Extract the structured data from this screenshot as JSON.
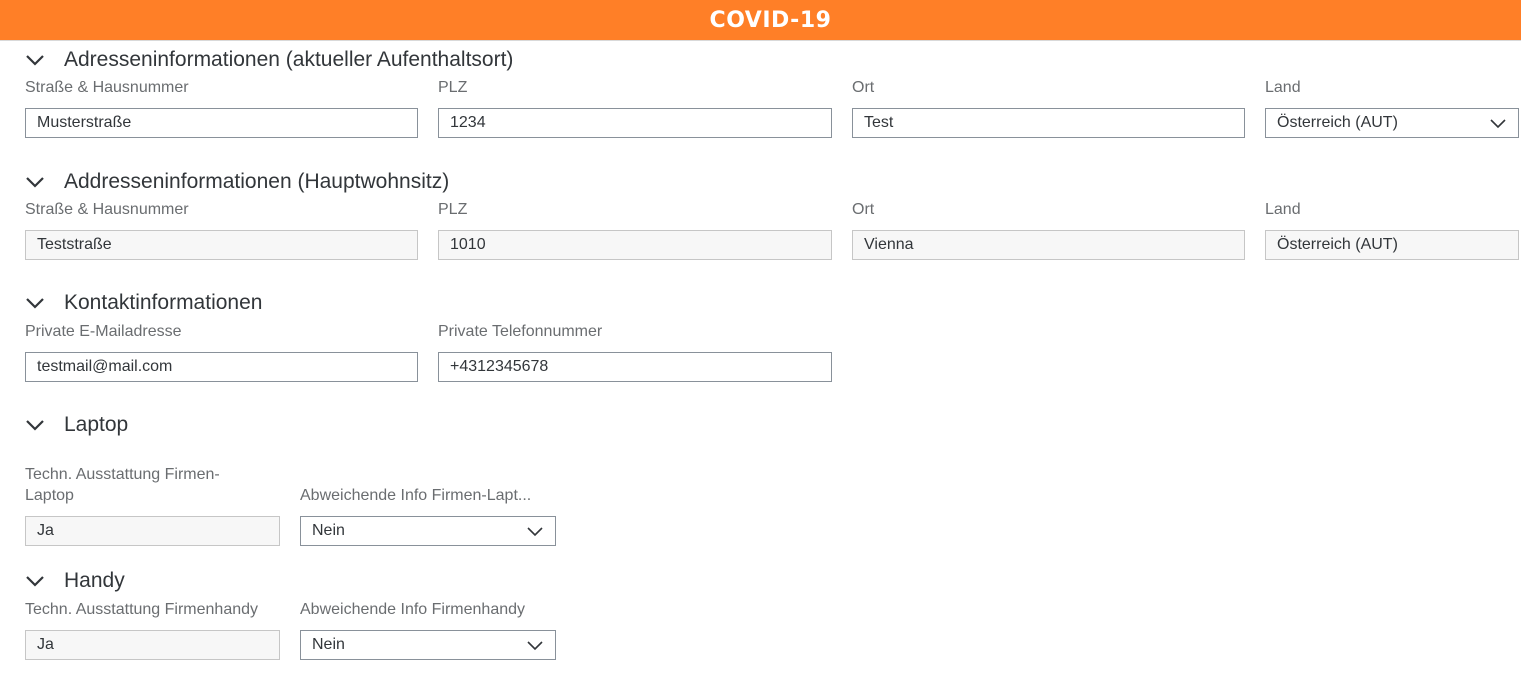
{
  "header": {
    "title": "COVID-19"
  },
  "current_address": {
    "heading": "Adresseninformationen (aktueller Aufenthaltsort)",
    "street_label": "Straße & Hausnummer",
    "street_value": "Musterstraße",
    "zip_label": "PLZ",
    "zip_value": "1234",
    "city_label": "Ort",
    "city_value": "Test",
    "country_label": "Land",
    "country_value": "Österreich (AUT)"
  },
  "main_address": {
    "heading": "Addresseninformationen (Hauptwohnsitz)",
    "street_label": "Straße & Hausnummer",
    "street_value": "Teststraße",
    "zip_label": "PLZ",
    "zip_value": "1010",
    "city_label": "Ort",
    "city_value": "Vienna",
    "country_label": "Land",
    "country_value": "Österreich (AUT)"
  },
  "contact": {
    "heading": "Kontaktinformationen",
    "email_label": "Private E-Mailadresse",
    "email_value": "testmail@mail.com",
    "phone_label": "Private Telefonnummer",
    "phone_value": "+4312345678"
  },
  "laptop": {
    "heading": "Laptop",
    "equipment_label_line1": "Techn. Ausstattung Firmen-",
    "equipment_label_line2": "Laptop",
    "equipment_value": "Ja",
    "deviating_label": "Abweichende Info Firmen-Lapt...",
    "deviating_value": "Nein"
  },
  "handy": {
    "heading": "Handy",
    "equipment_label": "Techn. Ausstattung Firmenhandy",
    "equipment_value": "Ja",
    "deviating_label": "Abweichende Info Firmenhandy",
    "deviating_value": "Nein"
  },
  "icons": {
    "section_toggle": "chevron-down-icon",
    "dropdown": "chevron-down-icon"
  },
  "colors": {
    "header_bg": "#ff7f27",
    "header_text": "#ffffff",
    "field_border": "#89919a",
    "readonly_bg": "#f7f7f7"
  }
}
